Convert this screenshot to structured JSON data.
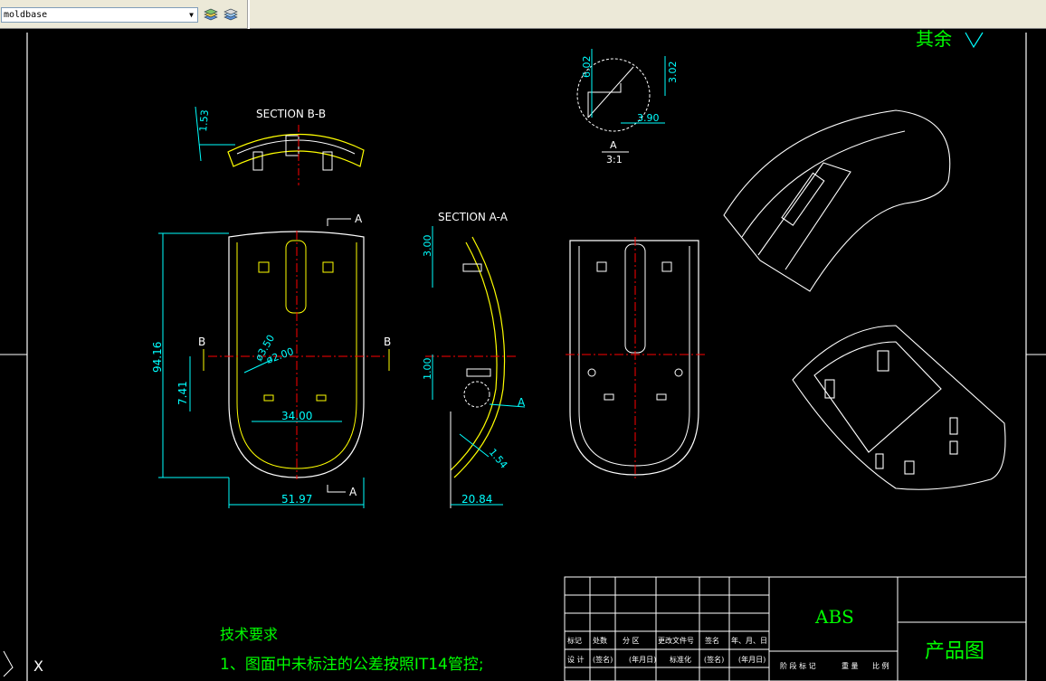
{
  "toolbar": {
    "layer_name": "moldbase",
    "dropdown_arrow": "chevron-down-icon",
    "icons": [
      "layer-stack-icon",
      "layer-states-icon"
    ]
  },
  "drawing": {
    "roughness_text": "其余",
    "section_bb": {
      "title": "SECTION B-B",
      "dim": "1.53"
    },
    "detail_a": {
      "title": "A",
      "scale": "3:1",
      "dims": [
        "6.02",
        "3.02",
        "3.90"
      ]
    },
    "section_aa": {
      "title": "SECTION A-A",
      "dims": [
        "3.00",
        "1.00",
        "1.54",
        "20.84"
      ],
      "detail_label": "A"
    },
    "top_view": {
      "dims": [
        "94.16",
        "7.41",
        "ø3.50",
        "ø2.00",
        "34.00",
        "51.97"
      ],
      "cut_labels": [
        "A",
        "A",
        "B",
        "B"
      ]
    },
    "tech_requirements": {
      "title": "技术要求",
      "line1": "1、图面中未标注的公差按照IT14管控;"
    },
    "ucs_label": "X"
  },
  "title_block": {
    "material": "ABS",
    "drawing_name": "产品图",
    "row_labels": [
      "标记",
      "处数",
      "分 区",
      "更改文件号",
      "签名",
      "年、月、日"
    ],
    "row_labels2": [
      "设 计",
      "(签名)",
      "(年月日)",
      "标准化",
      "(签名)",
      "(年月日)"
    ],
    "stage_labels": [
      "阶 段 标 记",
      "重 量",
      "比 例"
    ]
  },
  "colors": {
    "background": "#000000",
    "outline": "#ffffff",
    "dimension": "#00ffff",
    "part_line": "#ffff00",
    "center_line": "#ff0000",
    "text_green": "#00ff00",
    "toolbar_bg": "#ece9d8"
  }
}
